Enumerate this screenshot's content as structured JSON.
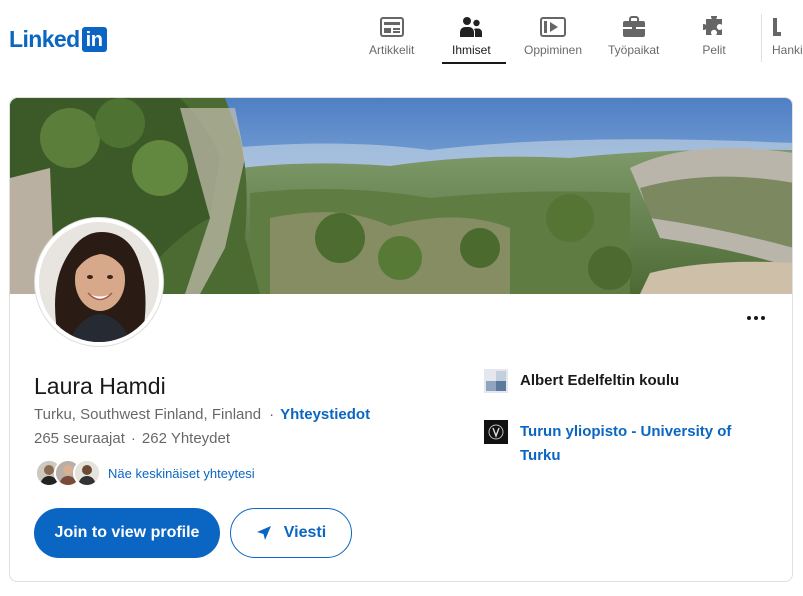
{
  "brand": {
    "logo_text": "Linked",
    "logo_in": "in",
    "color": "#0a66c2"
  },
  "nav": {
    "items": [
      {
        "label": "Artikkelit",
        "icon": "articles-icon"
      },
      {
        "label": "Ihmiset",
        "icon": "people-icon",
        "active": true
      },
      {
        "label": "Oppiminen",
        "icon": "learning-icon"
      },
      {
        "label": "Työpaikat",
        "icon": "jobs-icon"
      },
      {
        "label": "Pelit",
        "icon": "games-icon"
      },
      {
        "label": "Hanki",
        "icon": "get-app-icon"
      }
    ]
  },
  "profile": {
    "name": "Laura Hamdi",
    "location": "Turku, Southwest Finland, Finland",
    "contact_info": "Yhteystiedot",
    "followers": "265 seuraajat",
    "connections": "262 Yhteydet",
    "mutual_connections": "Näe keskinäiset yhteytesi",
    "more_icon": "more-horizontal-icon"
  },
  "actions": {
    "join": "Join to view profile",
    "message": "Viesti"
  },
  "education": [
    {
      "name": "Albert Edelfeltin koulu",
      "link": false
    },
    {
      "name": "Turun yliopisto - University of Turku",
      "link": true
    }
  ]
}
